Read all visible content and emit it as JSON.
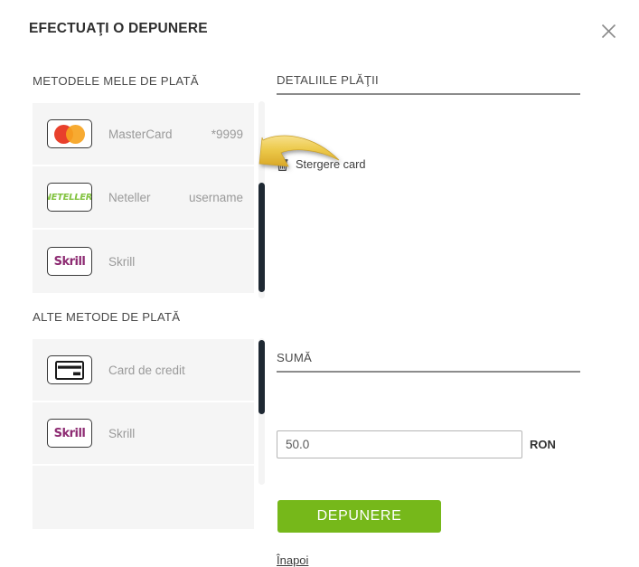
{
  "dialog": {
    "title": "EFECTUAŢI O DEPUNERE",
    "close_icon": "close-x-icon"
  },
  "left": {
    "saved_methods_label": "METODELE MELE DE PLATĂ",
    "other_methods_label": "ALTE METODE DE PLATĂ",
    "saved_methods": [
      {
        "logo": "mastercard-logo",
        "name": "MasterCard",
        "extra": "*9999"
      },
      {
        "logo": "neteller-logo",
        "name": "Neteller",
        "extra": "username"
      },
      {
        "logo": "skrill-logo",
        "name": "Skrill",
        "extra": ""
      }
    ],
    "other_methods": [
      {
        "logo": "credit-card-icon",
        "name": "Card de credit",
        "extra": ""
      },
      {
        "logo": "skrill-logo",
        "name": "Skrill",
        "extra": ""
      },
      {
        "logo": "",
        "name": "",
        "extra": ""
      }
    ],
    "logo_text": {
      "neteller": "NETELLER.",
      "skrill": "Skrill"
    }
  },
  "right": {
    "details_label": "DETALIILE PLĂŢII",
    "delete_card_label": "Stergere card",
    "delete_card_icon": "trash-icon",
    "amount_label": "SUMĂ",
    "amount_value": "50.0",
    "amount_placeholder": "50.0",
    "currency": "RON",
    "deposit_button": "DEPUNERE",
    "back_link": "Înapoi"
  },
  "annotation": {
    "arrow_icon": "curved-arrow-left-icon",
    "arrow_color": "#e8c34a"
  },
  "colors": {
    "deposit_green": "#76b81a",
    "mastercard_red": "#e8402c",
    "mastercard_yellow": "#f6a320",
    "neteller_green": "#83c341",
    "skrill_purple": "#8d2b72",
    "row_bg": "#f5f5f5",
    "scroll_thumb": "#1f2933"
  }
}
